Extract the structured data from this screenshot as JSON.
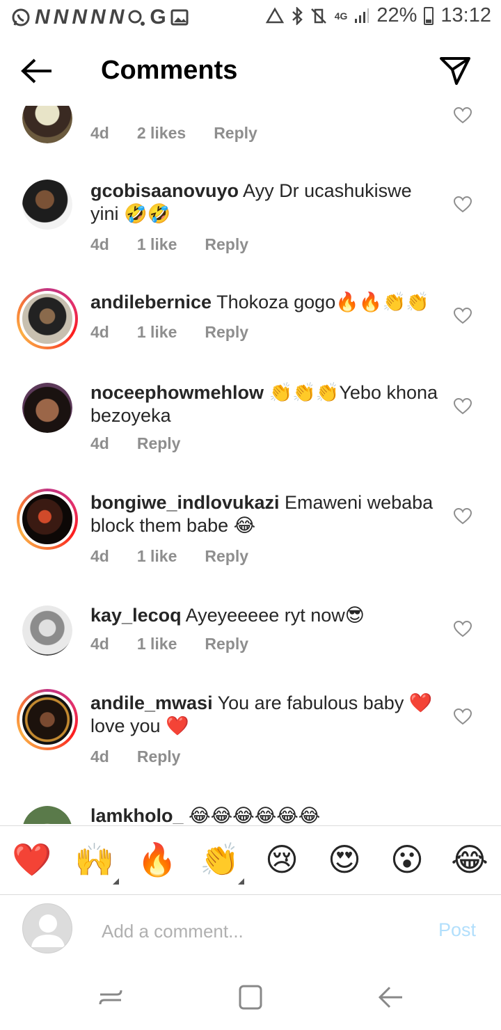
{
  "status_bar": {
    "left_glyphs": [
      "N",
      "N",
      "N",
      "N",
      "N"
    ],
    "g_label": "G",
    "network": "4G",
    "battery": "22%",
    "time": "13:12"
  },
  "header": {
    "title": "Comments"
  },
  "comments": [
    {
      "username": "",
      "text": "",
      "time": "4d",
      "likes": "2 likes",
      "reply": "Reply"
    },
    {
      "username": "gcobisaanovuyo",
      "text": " Ayy Dr ucashukiswe yini 🤣🤣",
      "time": "4d",
      "likes": "1 like",
      "reply": "Reply"
    },
    {
      "username": "andilebernice",
      "text": " Thokoza gogo🔥🔥👏👏",
      "time": "4d",
      "likes": "1 like",
      "reply": "Reply"
    },
    {
      "username": "noceephowmehlow",
      "text": " 👏👏👏Yebo khona bezoyeka",
      "time": "4d",
      "likes": "",
      "reply": "Reply"
    },
    {
      "username": "bongiwe_indlovukazi",
      "text": " Emaweni webaba block them babe 😂",
      "time": "4d",
      "likes": "1 like",
      "reply": "Reply"
    },
    {
      "username": "kay_lecoq",
      "text": " Ayeyeeeee ryt now😎",
      "time": "4d",
      "likes": "1 like",
      "reply": "Reply"
    },
    {
      "username": "andile_mwasi",
      "text": " You are fabulous baby ❤️ love you ❤️",
      "time": "4d",
      "likes": "",
      "reply": "Reply"
    },
    {
      "username": "lamkholo_",
      "text": " 😂😂😂😂😂😂",
      "time": "",
      "likes": "",
      "reply": ""
    }
  ],
  "reactions": [
    "❤️",
    "🙌",
    "🔥",
    "👏",
    "😢",
    "😍",
    "😮",
    "😂"
  ],
  "composer": {
    "placeholder": "Add a comment...",
    "post_label": "Post"
  },
  "colors": {
    "post_disabled": "#b2dffc",
    "meta_gray": "#8e8e8e",
    "heart_red": "#e0242c"
  }
}
